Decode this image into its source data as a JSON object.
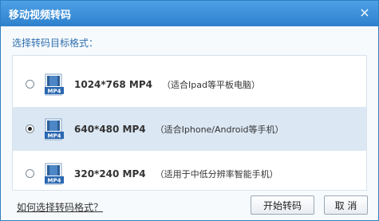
{
  "dialog": {
    "title": "移动视频转码",
    "close_glyph": "×"
  },
  "prompt": "选择转码目标格式：",
  "options": [
    {
      "resolution": "1024*768 MP4",
      "description": "（适合Ipad等平板电脑）",
      "selected": false,
      "icon_label": "MP4"
    },
    {
      "resolution": "640*480 MP4",
      "description": "（适合Iphone/Android等手机）",
      "selected": true,
      "icon_label": "MP4"
    },
    {
      "resolution": "320*240 MP4",
      "description": "（适用于中低分辨率智能手机）",
      "selected": false,
      "icon_label": "MP4"
    }
  ],
  "help_link": "如何选择转码格式？",
  "buttons": {
    "start": "开始转码",
    "cancel": "取 消"
  },
  "colors": {
    "titlebar": "#2e81cc",
    "selected_row": "#dbe7f3",
    "prompt_text": "#2f6fb0"
  }
}
